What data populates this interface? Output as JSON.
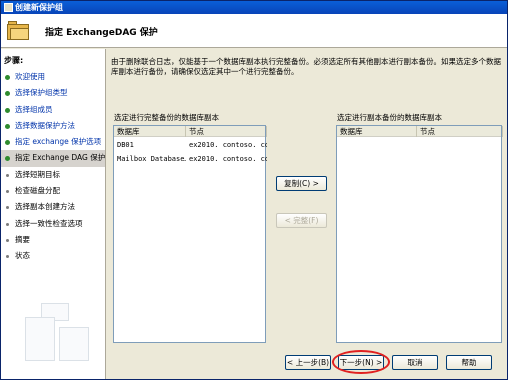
{
  "window": {
    "title": "创建新保护组"
  },
  "header": {
    "title": "指定 ExchangeDAG 保护"
  },
  "sidebar": {
    "heading": "步骤:",
    "items": [
      {
        "label": "欢迎使用",
        "state": "done"
      },
      {
        "label": "选择保护组类型",
        "state": "done"
      },
      {
        "label": "选择组成员",
        "state": "done"
      },
      {
        "label": "选择数据保护方法",
        "state": "done"
      },
      {
        "label": "指定 exchange 保护选项",
        "state": "done"
      },
      {
        "label": "指定 Exchange DAG 保护",
        "state": "current"
      },
      {
        "label": "选择短期目标",
        "state": "future"
      },
      {
        "label": "检查磁盘分配",
        "state": "future"
      },
      {
        "label": "选择副本创建方法",
        "state": "future"
      },
      {
        "label": "选择一致性检查选项",
        "state": "future"
      },
      {
        "label": "摘要",
        "state": "future"
      },
      {
        "label": "状态",
        "state": "future"
      }
    ]
  },
  "main": {
    "description": "由于删除联合日志，仅能基于一个数据库副本执行完整备份。必须选定所有其他副本进行副本备份。如果选定多个数据库副本进行备份，请确保仅选定其中一个进行完整备份。",
    "left_list": {
      "label": "选定进行完整备份的数据库副本",
      "columns": [
        "数据库",
        "节点"
      ],
      "rows": [
        {
          "database": "DB01",
          "node": "ex2010. contoso. com"
        },
        {
          "database": "Mailbox Database…",
          "node": "ex2010. contoso. com"
        }
      ]
    },
    "right_list": {
      "label": "选定进行副本备份的数据库副本",
      "columns": [
        "数据库",
        "节点"
      ]
    },
    "copy_button": "复制(C) >",
    "full_backup_button": "< 完整(F)"
  },
  "footer": {
    "back_button": "< 上一步(B)",
    "next_button": "下一步(N) >",
    "cancel_button": "取消",
    "help_button": "帮助"
  },
  "colors": {
    "title_bar": "#0a5fd8",
    "current_step_bg": "#d6d3ce",
    "highlight_ring": "#e02020"
  }
}
